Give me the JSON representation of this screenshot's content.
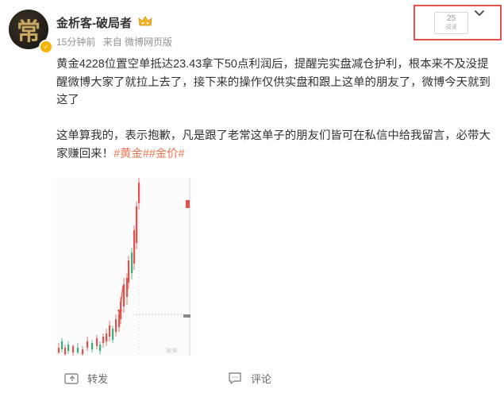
{
  "author": {
    "name": "金析客-破局者",
    "avatar_char": "常",
    "verified_icon": "v-verified-icon",
    "badge_icon": "crown-badge-icon"
  },
  "meta": {
    "time": "15分钟前",
    "source": "来自 微博网页版"
  },
  "read": {
    "count": "25",
    "label": "阅读"
  },
  "post": {
    "paragraph1": "黄金4228位置空单抵达23.43拿下50点利润后，提醒完实盘减仓护利，根本来不及没提醒微博大家了就拉上去了，接下来的操作仅供实盘和跟上这单的朋友了，微博今天就到这了",
    "paragraph2": "这单算我的，表示抱歉，凡是跟了老常这单子的朋友们皆可在私信中给我留言，必带大家赚回来！",
    "hashtags": [
      "#黄金#",
      "#金价#"
    ]
  },
  "image": {
    "watermark": "微博"
  },
  "actions": {
    "repost_label": "转发",
    "comment_label": "评论"
  },
  "colors": {
    "hashtag": "#eb7350",
    "highlight_box": "#e8514b",
    "candle_up": "#e8514b",
    "candle_down": "#2fb37a"
  }
}
